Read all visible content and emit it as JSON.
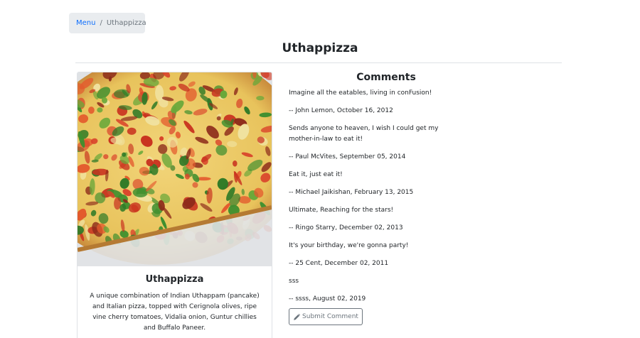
{
  "breadcrumb": {
    "menu_label": "Menu",
    "separator": "/",
    "current": "Uthappizza"
  },
  "page_title": "Uthappizza",
  "dish": {
    "name": "Uthappizza",
    "description": "A unique combination of Indian Uthappam (pancake) and Italian pizza, topped with Cerignola olives, ripe vine cherry tomatoes, Vidalia onion, Guntur chillies and Buffalo Paneer.",
    "image_icon": "pizza-photo"
  },
  "comments_section": {
    "title": "Comments",
    "items": [
      {
        "text": "Imagine all the eatables, living in conFusion!",
        "meta": "-- John Lemon,  October 16, 2012"
      },
      {
        "text": "Sends anyone to heaven, I wish I could get my mother-in-law to eat it!",
        "meta": "-- Paul McVites,  September 05, 2014"
      },
      {
        "text": "Eat it, just eat it!",
        "meta": "-- Michael Jaikishan,  February 13, 2015"
      },
      {
        "text": "Ultimate, Reaching for the stars!",
        "meta": "-- Ringo Starry,  December 02, 2013"
      },
      {
        "text": "It's your birthday, we're gonna party!",
        "meta": "-- 25 Cent,  December 02, 2011"
      },
      {
        "text": "sss",
        "meta": "-- ssss,  August 02, 2019"
      }
    ],
    "submit_label": "Submit Comment",
    "submit_icon": "pencil-icon"
  },
  "colors": {
    "link": "#0d6efd",
    "breadcrumb_bg": "#e9ecef",
    "button_border": "#6c757d"
  }
}
